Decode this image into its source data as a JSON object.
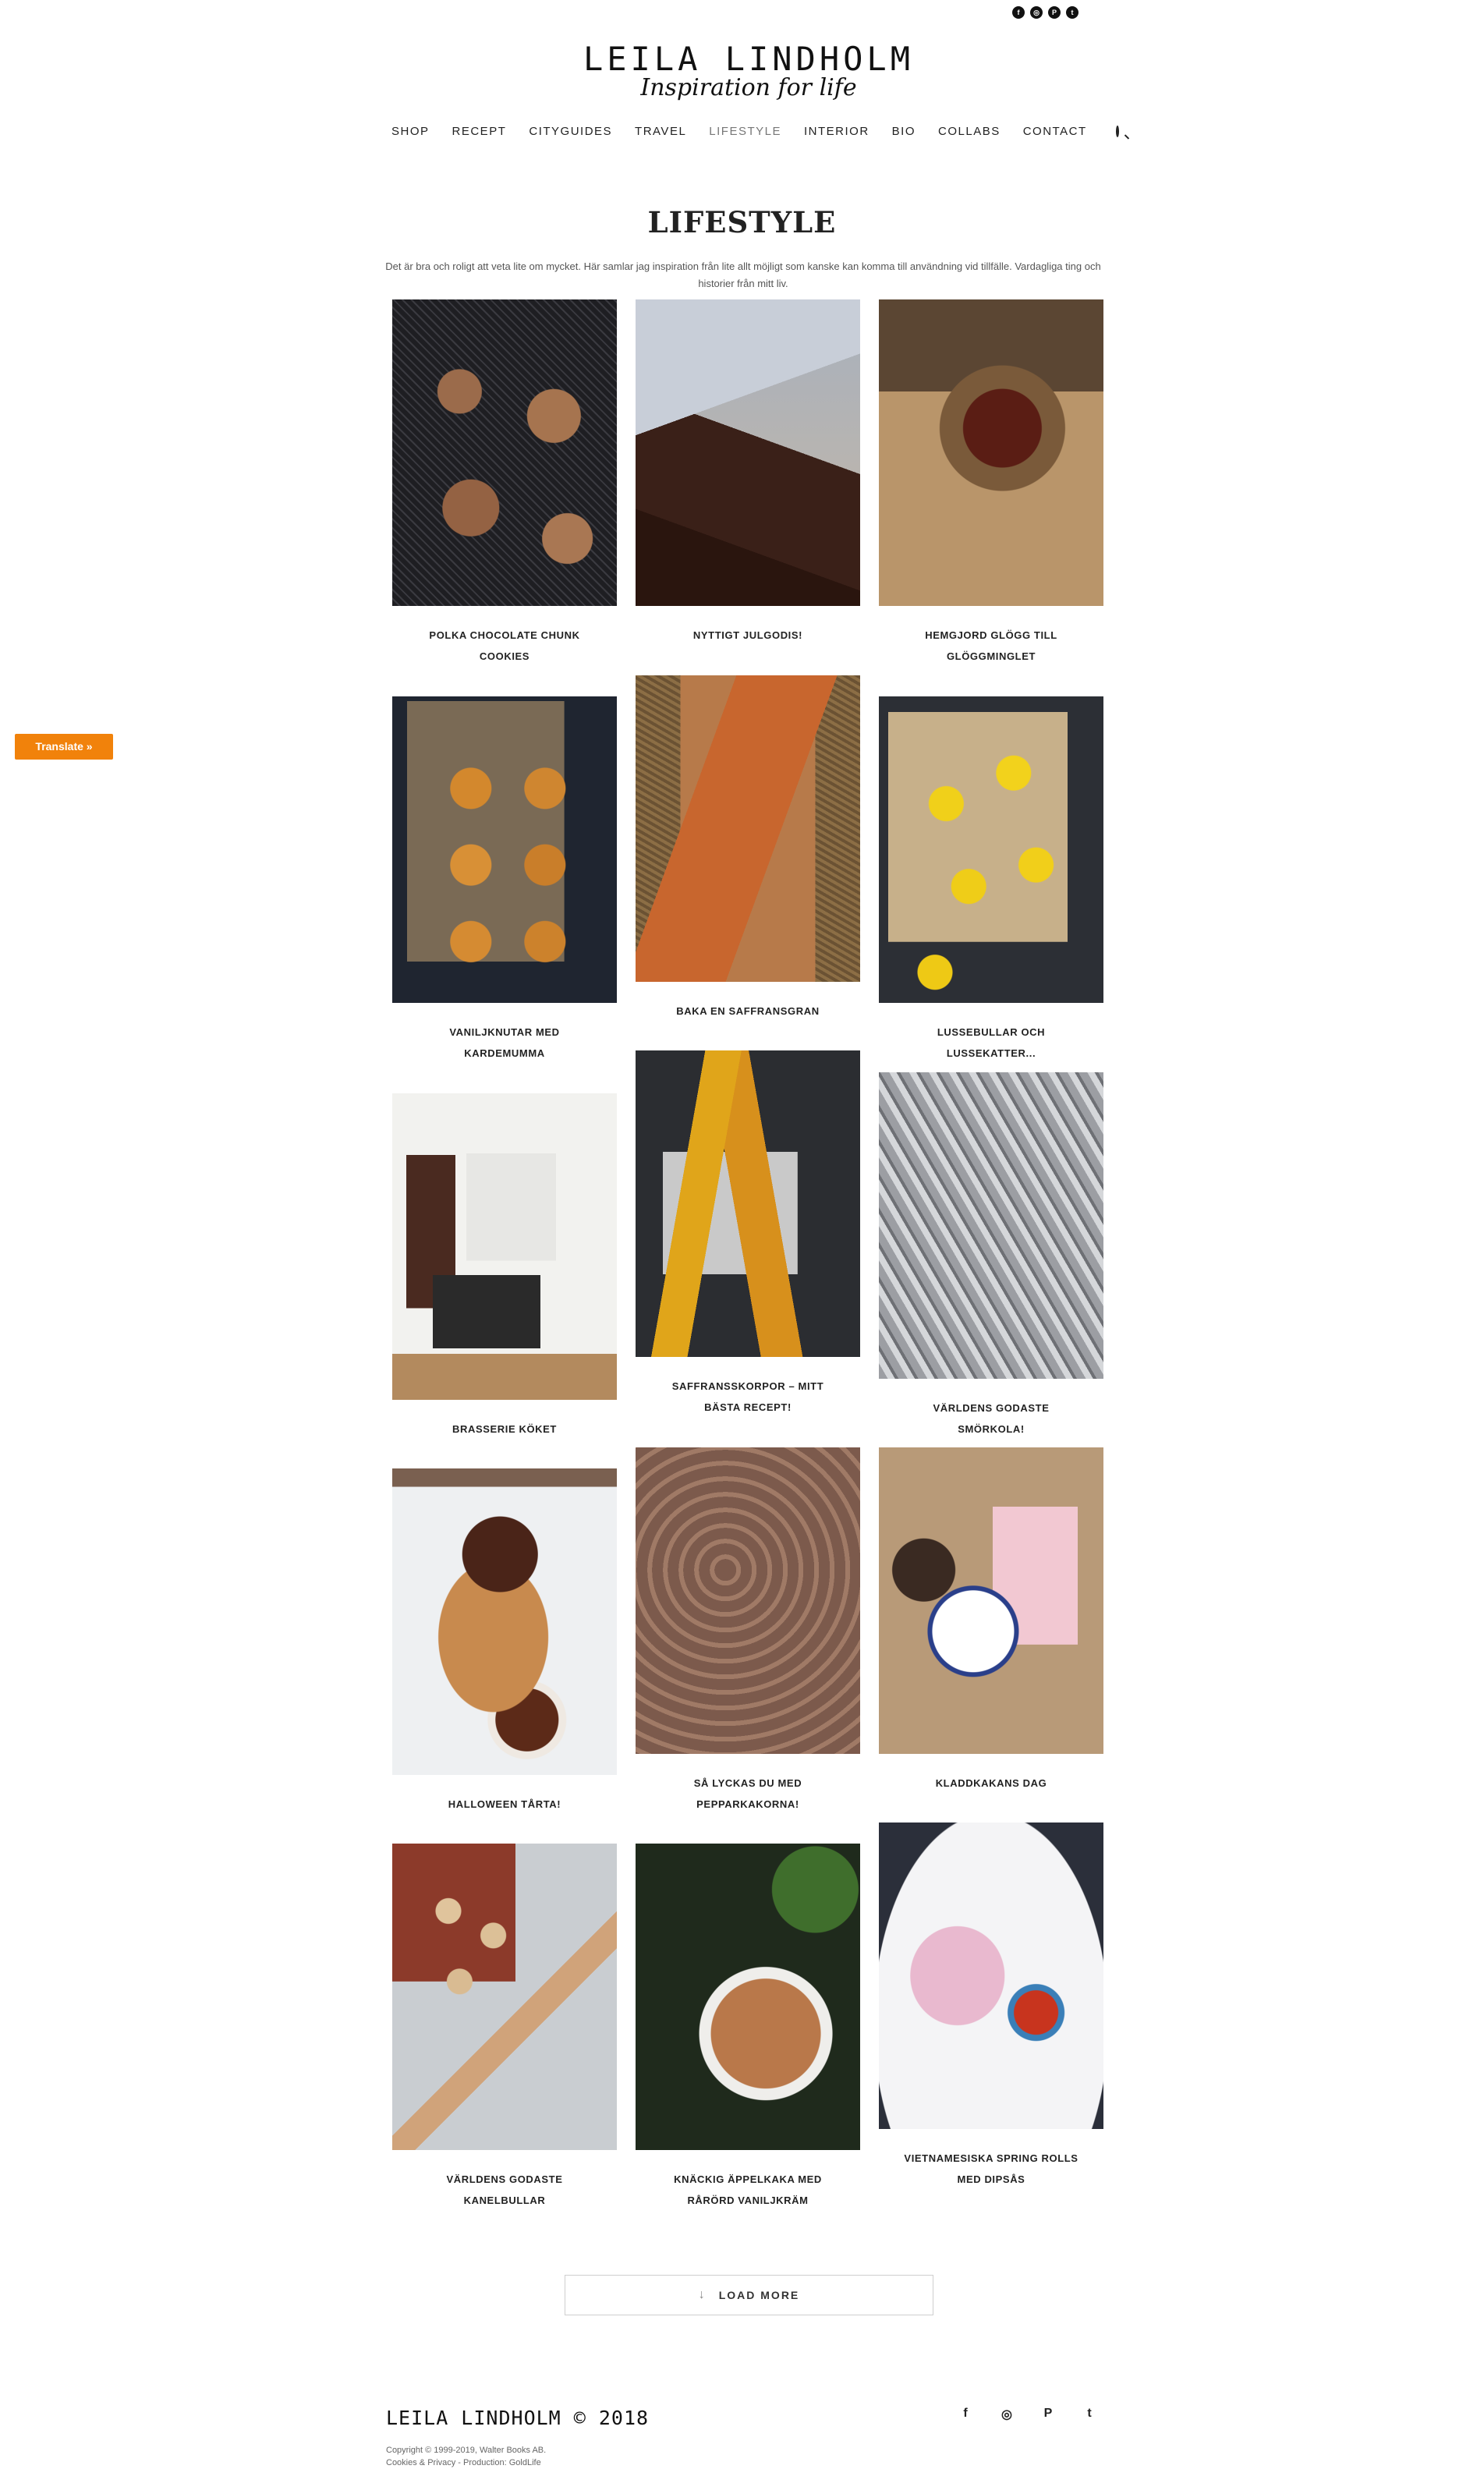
{
  "social_top": [
    {
      "icon": "facebook-icon",
      "glyph": "f"
    },
    {
      "icon": "instagram-icon",
      "glyph": "◎"
    },
    {
      "icon": "pinterest-icon",
      "glyph": "P"
    },
    {
      "icon": "twitter-icon",
      "glyph": "t"
    }
  ],
  "logo": {
    "name": "LEILA LINDHOLM",
    "tagline": "Inspiration for life"
  },
  "nav": {
    "items": [
      "SHOP",
      "RECEPT",
      "CITYGUIDES",
      "TRAVEL",
      "LIFESTYLE",
      "INTERIOR",
      "BIO",
      "COLLABS",
      "CONTACT"
    ],
    "active": "LIFESTYLE",
    "search_icon": "search-icon"
  },
  "page": {
    "title": "LIFESTYLE",
    "intro": "Det är bra och roligt att veta lite om mycket. Här samlar jag inspiration från lite allt möjligt som kanske kan komma till användning vid tillfälle. Vardagliga ting och historier från mitt liv."
  },
  "translate": {
    "label": "Translate »"
  },
  "posts": [
    {
      "caption": "POLKA CHOCOLATE CHUNK COOKIES"
    },
    {
      "caption": "NYTTIGT JULGODIS!"
    },
    {
      "caption": "HEMGJORD GLÖGG TILL GLÖGGMINGLET"
    },
    {
      "caption": "VANILJKNUTAR MED KARDEMUMMA"
    },
    {
      "caption": "BAKA EN SAFFRANSGRAN"
    },
    {
      "caption": "LUSSEBULLAR OCH LUSSEKATTER..."
    },
    {
      "caption": "BRASSERIE KÖKET"
    },
    {
      "caption": "SAFFRANSSKORPOR – MITT BÄSTA RECEPT!"
    },
    {
      "caption": "VÄRLDENS GODASTE SMÖRKOLA!"
    },
    {
      "caption": "HALLOWEEN TÅRTA!"
    },
    {
      "caption": "SÅ LYCKAS DU MED PEPPARKAKORNA!"
    },
    {
      "caption": "KLADDKAKANS DAG"
    },
    {
      "caption": "VÄRLDENS GODASTE KANELBULLAR"
    },
    {
      "caption": "KNÄCKIG ÄPPELKAKA MED RÅRÖRD VANILJKRÄM"
    },
    {
      "caption": "VIETNAMESISKA SPRING ROLLS MED DIPSÅS"
    }
  ],
  "load_more": {
    "label": "LOAD MORE",
    "icon": "arrow-down-icon"
  },
  "footer": {
    "brand": "LEILA LINDHOLM © 2018",
    "copyright": "Copyright © 1999-2019, Walter Books AB.",
    "links": "Cookies & Privacy - Production: GoldLife",
    "social": [
      {
        "icon": "facebook-icon",
        "glyph": "f"
      },
      {
        "icon": "instagram-icon",
        "glyph": "◎"
      },
      {
        "icon": "pinterest-icon",
        "glyph": "P"
      },
      {
        "icon": "twitter-icon",
        "glyph": "t"
      }
    ]
  }
}
